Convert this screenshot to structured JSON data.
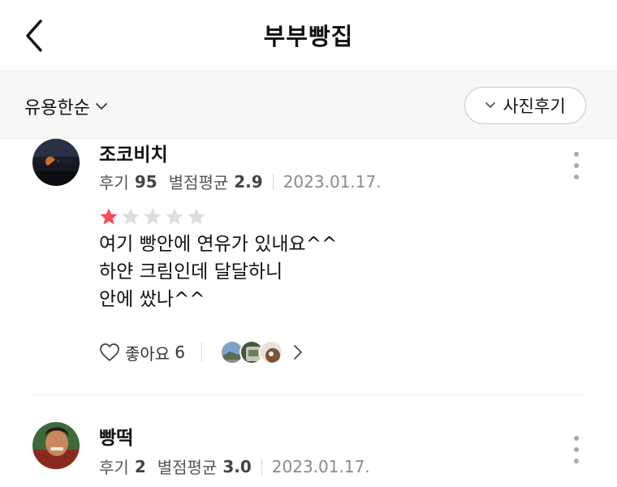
{
  "header": {
    "title": "부부빵집",
    "back_icon": "chevron-left-icon"
  },
  "filter": {
    "sort_label": "유용한순",
    "photo_filter_label": "사진후기"
  },
  "reviews": [
    {
      "name": "조코비치",
      "review_count_label": "후기",
      "review_count": "95",
      "avg_label": "별점평균",
      "avg_rating": "2.9",
      "date": "2023.01.17.",
      "rating": 1,
      "max_rating": 5,
      "lines": [
        "여기 빵안에 연유가 있내요^^",
        "하얀 크림인데 달달하니",
        "안에 쌌나^^"
      ],
      "like_label": "좋아요",
      "like_count": "6"
    },
    {
      "name": "빵떡",
      "review_count_label": "후기",
      "review_count": "2",
      "avg_label": "별점평균",
      "avg_rating": "3.0",
      "date": "2023.01.17."
    }
  ],
  "colors": {
    "star_active": "#f2505a",
    "star_inactive": "#dddddd",
    "muted_text": "#8a8a8a"
  }
}
